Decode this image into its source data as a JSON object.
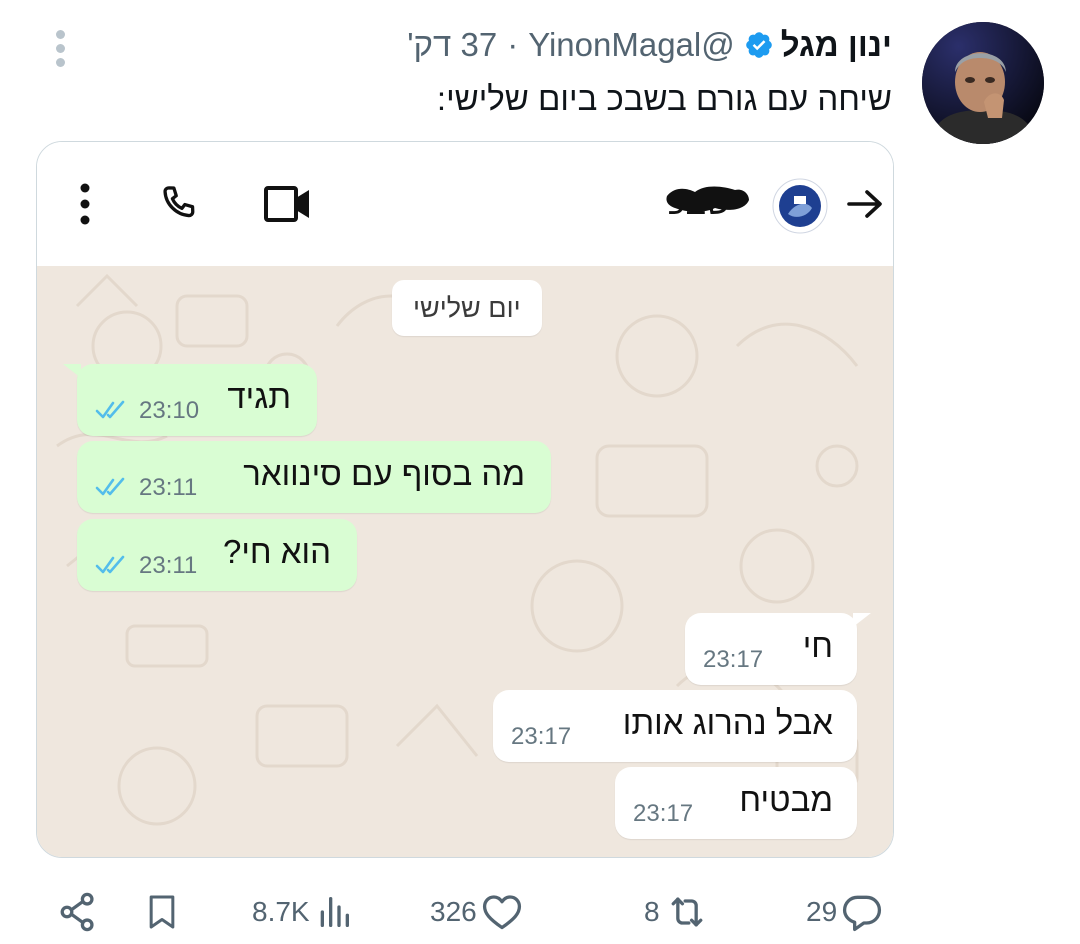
{
  "tweet": {
    "author_name": "ינון מגל",
    "handle": "@YinonMagal",
    "separator": "·",
    "age": "37 דק'",
    "text": "שיחה עם גורם בשבכ ביום שלישי:"
  },
  "chat_screenshot": {
    "contact_name": "י שבכ",
    "day_label": "יום שלישי",
    "messages": [
      {
        "direction": "outgoing",
        "text": "תגיד",
        "time": "23:10",
        "status": "read"
      },
      {
        "direction": "outgoing",
        "text": "מה בסוף עם סינוואר",
        "time": "23:11",
        "status": "read"
      },
      {
        "direction": "outgoing",
        "text": "הוא חי?",
        "time": "23:11",
        "status": "read"
      },
      {
        "direction": "incoming",
        "text": "חי",
        "time": "23:17"
      },
      {
        "direction": "incoming",
        "text": "אבל נהרוג אותו",
        "time": "23:17"
      },
      {
        "direction": "incoming",
        "text": "מבטיח",
        "time": "23:17"
      }
    ],
    "colors": {
      "outgoing_bubble": "#d9fdd3",
      "incoming_bubble": "#ffffff",
      "chat_background": "#efe7de",
      "read_ticks": "#53bdeb"
    }
  },
  "actions": {
    "replies": "29",
    "retweets": "8",
    "likes": "326",
    "views": "8.7K"
  },
  "colors": {
    "verified_badge": "#1d9bf0",
    "secondary_text": "#536471"
  },
  "icons": [
    "more-icon",
    "verified-badge-icon",
    "back-arrow-icon",
    "video-call-icon",
    "phone-icon",
    "kebab-menu-icon",
    "double-check-icon",
    "reply-icon",
    "retweet-icon",
    "like-icon",
    "views-icon",
    "bookmark-icon",
    "share-icon"
  ]
}
